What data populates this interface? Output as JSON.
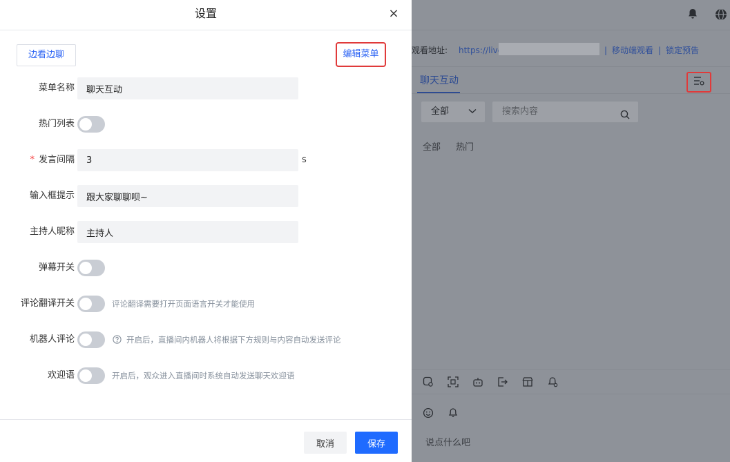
{
  "drawer": {
    "title": "设置",
    "close": "×",
    "menu_chip": "边看边聊",
    "edit_menu": "编辑菜单",
    "fields": {
      "menu_name": {
        "label": "菜单名称",
        "value": "聊天互动"
      },
      "hot_list": {
        "label": "热门列表",
        "on": false
      },
      "speak_interval": {
        "label": "发言间隔",
        "required_mark": "*",
        "value": "3",
        "unit": "s"
      },
      "input_hint": {
        "label": "输入框提示",
        "value": "跟大家聊聊呗~"
      },
      "host_nickname": {
        "label": "主持人昵称",
        "value": "主持人"
      },
      "barrage": {
        "label": "弹幕开关",
        "on": false
      },
      "comment_translate": {
        "label": "评论翻译开关",
        "on": false,
        "hint": "评论翻译需要打开页面语言开关才能使用"
      },
      "robot_comment": {
        "label": "机器人评论",
        "on": false,
        "hint": "开启后，直播间内机器人将根据下方规则与内容自动发送评论"
      },
      "welcome": {
        "label": "欢迎语",
        "on": false,
        "hint": "开启后，观众进入直播间时系统自动发送聊天欢迎语"
      }
    },
    "footer": {
      "cancel": "取消",
      "save": "保存"
    }
  },
  "background": {
    "watch_address_label": "观看地址:",
    "watch_url": "https://live",
    "separator": "|",
    "mobile_watch": "移动端观看",
    "lock_preview": "锁定预告",
    "chat_tab": "聊天互动",
    "filter_selected": "全部",
    "search_placeholder": "搜索内容",
    "sub_tabs": [
      "全部",
      "热门"
    ],
    "composer_placeholder": "说点什么吧"
  },
  "colors": {
    "primary": "#1f6bff",
    "link": "#2b63f4",
    "highlight_border": "#e03a3a",
    "switch_off": "#c9cdd4",
    "overlay": "#8e9299"
  }
}
